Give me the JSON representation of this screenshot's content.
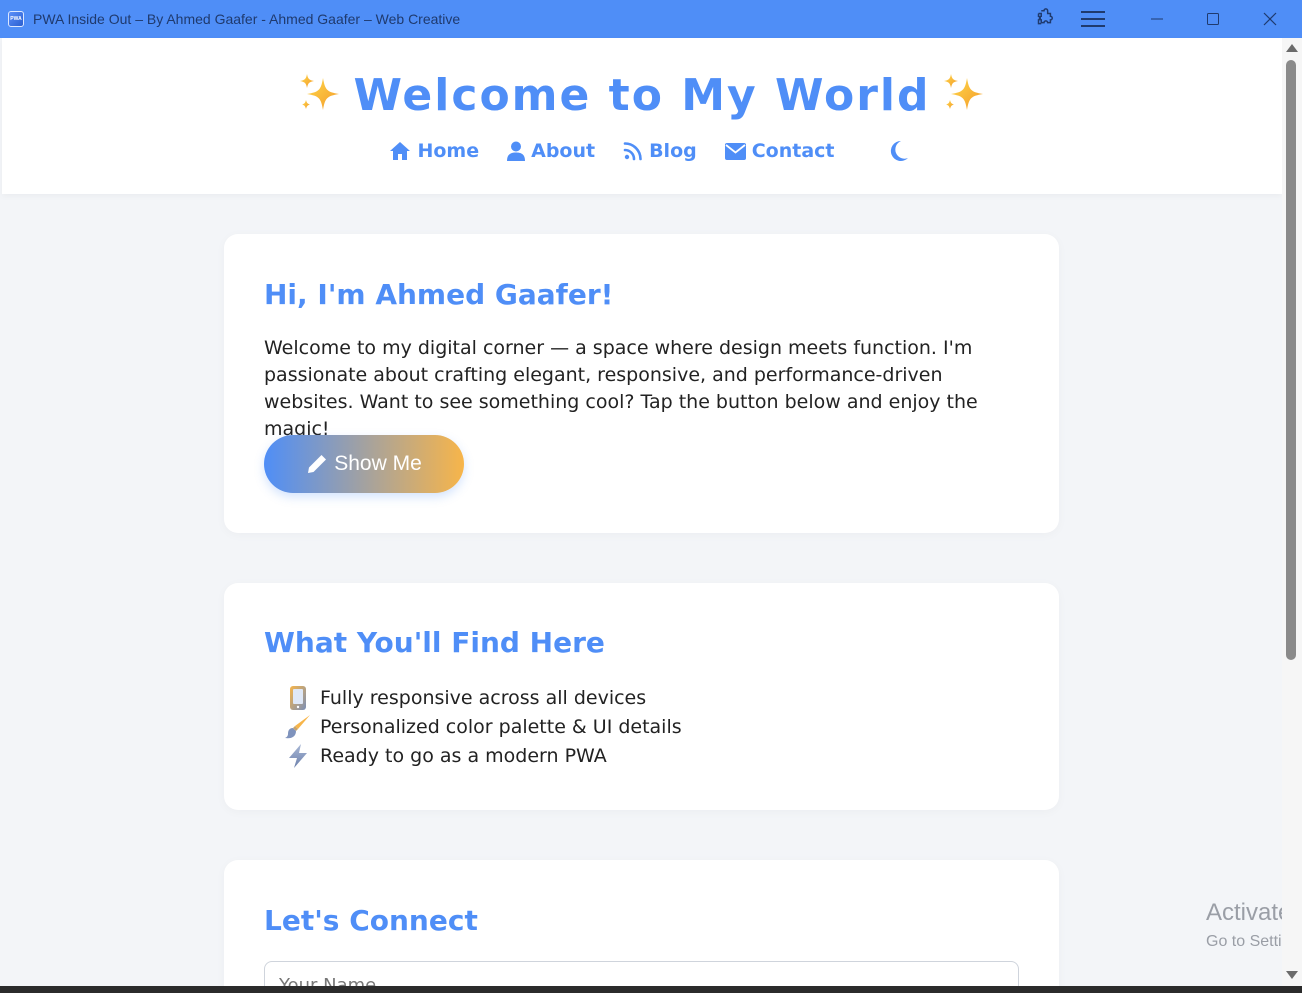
{
  "window": {
    "app_icon_text": "PWA",
    "title": "PWA Inside Out – By Ahmed Gaafer - Ahmed Gaafer – Web Creative"
  },
  "header": {
    "title": "Welcome to My World",
    "sparkle_emoji": "✨",
    "nav": [
      {
        "label": "Home",
        "icon": "home-icon"
      },
      {
        "label": "About",
        "icon": "user-icon"
      },
      {
        "label": "Blog",
        "icon": "rss-icon"
      },
      {
        "label": "Contact",
        "icon": "envelope-icon"
      }
    ],
    "theme_toggle_icon": "moon-icon"
  },
  "hero": {
    "heading": "Hi, I'm Ahmed Gaafer!",
    "text": "Welcome to my digital corner — a space where design meets function. I'm passionate about crafting elegant, responsive, and performance-driven websites. Want to see something cool? Tap the button below and enjoy the magic!",
    "button_label": "Show Me",
    "button_icon": "pencil-icon"
  },
  "features": {
    "heading": "What You'll Find Here",
    "items": [
      {
        "icon": "mobile-phone-icon",
        "text": "Fully responsive across all devices"
      },
      {
        "icon": "paintbrush-icon",
        "text": " Personalized color palette & UI details"
      },
      {
        "icon": "lightning-icon",
        "text": " Ready to go as a modern PWA"
      }
    ]
  },
  "connect": {
    "heading": "Let's Connect",
    "name_placeholder": "Your Name"
  },
  "watermark": {
    "title": "Activate Windows",
    "subtitle": "Go to Settings to activate Windows."
  },
  "colors": {
    "accent": "#4f8ef7",
    "button_gradient_end": "#f7b54a",
    "page_background": "#f3f5f8",
    "titlebar": "#4f8ef7"
  }
}
